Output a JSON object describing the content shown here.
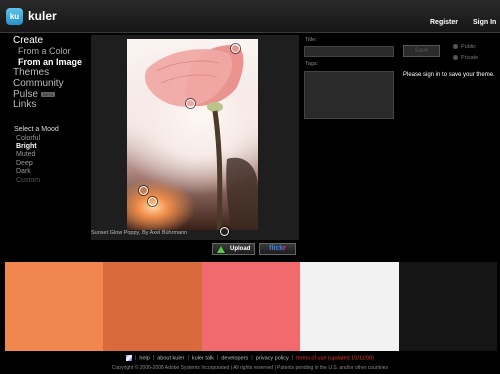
{
  "header": {
    "logo_badge": "ku",
    "app_name": "kuler",
    "register": "Register",
    "sign_in": "Sign In"
  },
  "nav": {
    "create": "Create",
    "from_color": "From a Color",
    "from_image": "From an Image",
    "themes": "Themes",
    "community": "Community",
    "pulse": "Pulse",
    "pulse_badge": "BETA",
    "links": "Links"
  },
  "mood": {
    "title": "Select a Mood",
    "items": [
      "Colorful",
      "Bright",
      "Muted",
      "Deep",
      "Dark",
      "Custom"
    ],
    "selected": "Bright"
  },
  "image": {
    "caption": "Sunset Glow Poppy, By Axel Bührmann"
  },
  "buttons": {
    "upload": "Upload",
    "flickr_a": "flick",
    "flickr_b": "r"
  },
  "form": {
    "title_label": "Title:",
    "tags_label": "Tags:",
    "save_label": "Save",
    "public_label": "Public",
    "private_label": "Private",
    "signin_message": "Please sign in to save your theme."
  },
  "swatches": [
    "#f0874f",
    "#d96a3c",
    "#f06a6e",
    "#f2f2f2",
    "#151515"
  ],
  "footer": {
    "help": "help",
    "about": "about kuler",
    "talk": "kuler talk",
    "developers": "developers",
    "privacy": "privacy policy",
    "terms": "terms of use (updated 10/11/08)",
    "copyright": "Copyright © 2006-2008 Adobe Systems Incorporated | All rights reserved | Patents pending in the U.S. and/or other countries"
  }
}
